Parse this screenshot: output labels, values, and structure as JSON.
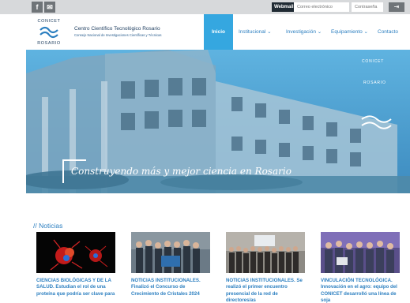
{
  "topbar": {
    "facebook_icon": "f",
    "mail_icon": "✉",
    "webmail_label": "Webmail",
    "email_placeholder": "Correo electrónico",
    "password_placeholder": "Contraseña",
    "login_icon": "⇥"
  },
  "header": {
    "logo_top": "CONICET",
    "logo_bottom": "ROSARIO",
    "org_name": "Centro Científico Tecnológico Rosario",
    "org_subtitle": "Consejo Nacional de Investigaciones Científicas y Técnicas"
  },
  "nav": {
    "items": [
      {
        "label": "Inicio"
      },
      {
        "label": "Institucional ⌄"
      },
      {
        "label": "Investigación ⌄"
      },
      {
        "label": "Equipamiento ⌄"
      },
      {
        "label": "Contacto"
      }
    ]
  },
  "hero": {
    "caption": "Construyendo más y mejor ciencia en Rosario",
    "logo_top": "CONICET",
    "logo_bottom": "ROSARIO"
  },
  "news": {
    "section_title": "// Noticias",
    "items": [
      {
        "text": "CIENCIAS BIOLÓGICAS Y DE LA SALUD. Estudian el rol de una proteína que podría ser clave para"
      },
      {
        "text": "NOTICIAS INSTITUCIONALES. Finalizó el Concurso de Crecimiento de Cristales 2024"
      },
      {
        "text": "NOTICIAS INSTITUCIONALES. Se realizó el primer encuentro presencial de la red de directores/as"
      },
      {
        "text": "VINCULACIÓN TECNOLÓGICA. Innovación en el agro: equipo del CONICET desarrolló una línea de soja"
      }
    ]
  },
  "colors": {
    "accent": "#35a7e0",
    "link": "#2c7fc0",
    "topbar": "#d7d9db"
  }
}
